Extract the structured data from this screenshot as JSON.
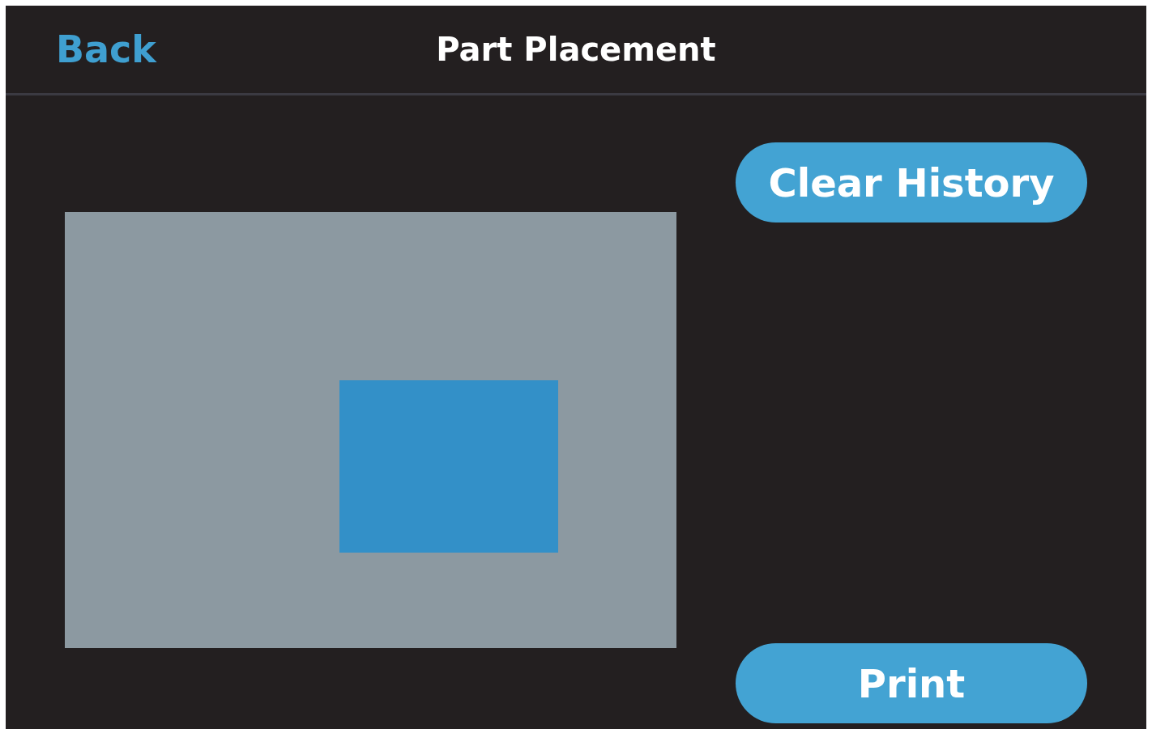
{
  "header": {
    "back": "Back",
    "title": "Part Placement"
  },
  "buttons": [
    {
      "label": "Clear History"
    },
    {
      "label": "Print"
    }
  ]
}
